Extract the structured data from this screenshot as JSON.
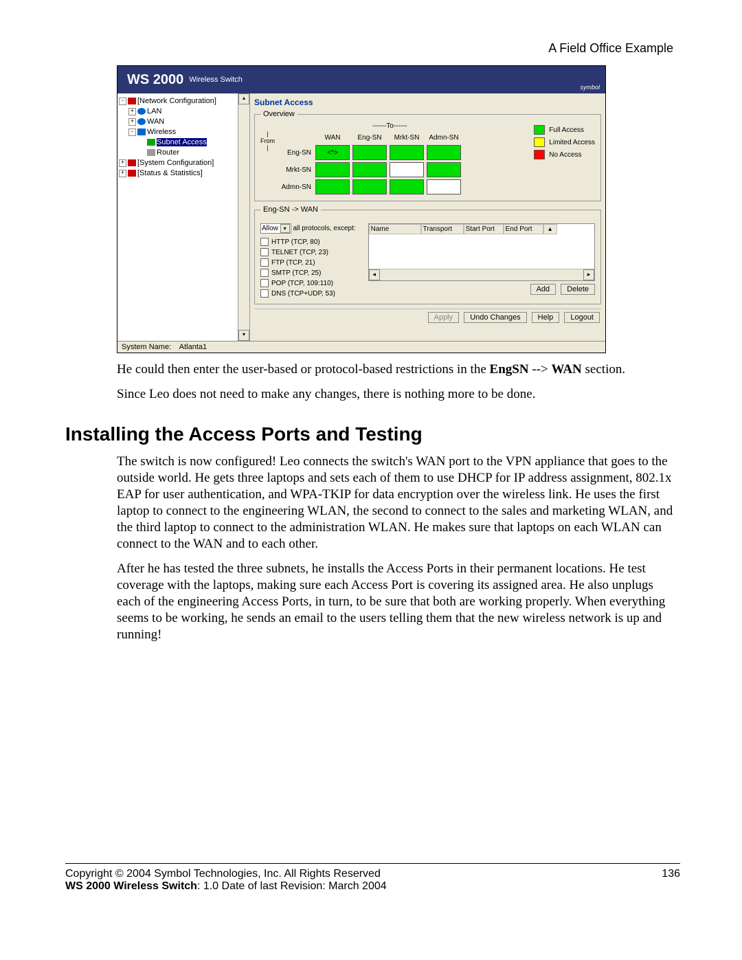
{
  "header": {
    "right": "A Field Office Example"
  },
  "banner": {
    "title": "WS 2000",
    "subtitle": "Wireless Switch",
    "brand": "symbol"
  },
  "tree": {
    "items": [
      {
        "pm": "⊟",
        "ic": "ic-net",
        "label": "[Network Configuration]",
        "indent": 0
      },
      {
        "pm": "⊞",
        "ic": "ic-lan",
        "label": "LAN",
        "indent": 1
      },
      {
        "pm": "⊞",
        "ic": "ic-wan",
        "label": "WAN",
        "indent": 1
      },
      {
        "pm": "⊟",
        "ic": "ic-wl",
        "label": "Wireless",
        "indent": 1
      },
      {
        "pm": "",
        "ic": "ic-sa",
        "label": "Subnet Access",
        "indent": 2,
        "sel": true
      },
      {
        "pm": "",
        "ic": "ic-rt",
        "label": "Router",
        "indent": 2
      },
      {
        "pm": "⊞",
        "ic": "ic-net",
        "label": "[System Configuration]",
        "indent": 0
      },
      {
        "pm": "⊞",
        "ic": "ic-net",
        "label": "[Status & Statistics]",
        "indent": 0
      }
    ]
  },
  "panel": {
    "title": "Subnet Access",
    "overview": {
      "legend": "Overview",
      "to": "------To------",
      "from": "From",
      "cols": [
        "WAN",
        "Eng-SN",
        "Mrkt-SN",
        "Admn-SN"
      ],
      "rows": [
        "Eng-SN",
        "Mrkt-SN",
        "Admn-SN"
      ],
      "sel_mark": "<*>",
      "grid": [
        [
          "sel",
          "g",
          "g",
          "g"
        ],
        [
          "g",
          "g",
          "w",
          "g"
        ],
        [
          "g",
          "g",
          "g",
          "w"
        ]
      ],
      "legend_items": [
        {
          "color": "g",
          "label": "Full Access"
        },
        {
          "color": "y",
          "label": "Limited Access"
        },
        {
          "color": "r",
          "label": "No Access"
        }
      ]
    },
    "rules": {
      "legend": "Eng-SN -> WAN",
      "allow_prefix": "Allow",
      "allow_suffix": "all protocols, except:",
      "protocols": [
        "HTTP (TCP, 80)",
        "TELNET (TCP, 23)",
        "FTP (TCP, 21)",
        "SMTP (TCP, 25)",
        "POP (TCP, 109:110)",
        "DNS (TCP+UDP, 53)"
      ],
      "table_cols": [
        "Name",
        "Transport",
        "Start Port",
        "End Port"
      ],
      "add": "Add",
      "delete": "Delete"
    },
    "buttons": {
      "apply": "Apply",
      "undo": "Undo Changes",
      "help": "Help",
      "logout": "Logout"
    }
  },
  "status": {
    "label": "System Name:",
    "value": "Atlanta1"
  },
  "doc": {
    "p1a": "He could then enter the user-based or protocol-based restrictions in the ",
    "p1b": "EngSN",
    "p1c": " --> ",
    "p1d": "WAN",
    "p1e": " section.",
    "p2": "Since Leo does not need to make any changes, there is nothing more to be done.",
    "h2": "Installing the Access Ports and Testing",
    "p3": "The switch is now configured! Leo connects the switch's WAN port to the VPN appliance that goes to the outside world. He gets three laptops and sets each of them to use DHCP for IP address assignment, 802.1x EAP for user authentication, and WPA-TKIP for data encryption over the wireless link. He uses the first laptop to connect to the engineering WLAN, the second to connect to the sales and marketing WLAN, and the third laptop to connect to the administration WLAN. He makes sure that laptops on each WLAN can connect to the WAN and to each other.",
    "p4": "After he has tested the three subnets, he installs the Access Ports in their permanent locations. He test coverage with the laptops, making sure each Access Port is covering its assigned area. He also unplugs each of the engineering Access Ports, in turn, to be sure that both are working properly. When everything seems to be working, he sends an email to the users telling them that the new wireless network is up and running!"
  },
  "footer": {
    "copyright": "Copyright © 2004 Symbol Technologies, Inc. All Rights Reserved",
    "page": "136",
    "line2a": "WS 2000 Wireless Switch",
    "line2b": ": 1.0  Date of last Revision: March 2004"
  }
}
